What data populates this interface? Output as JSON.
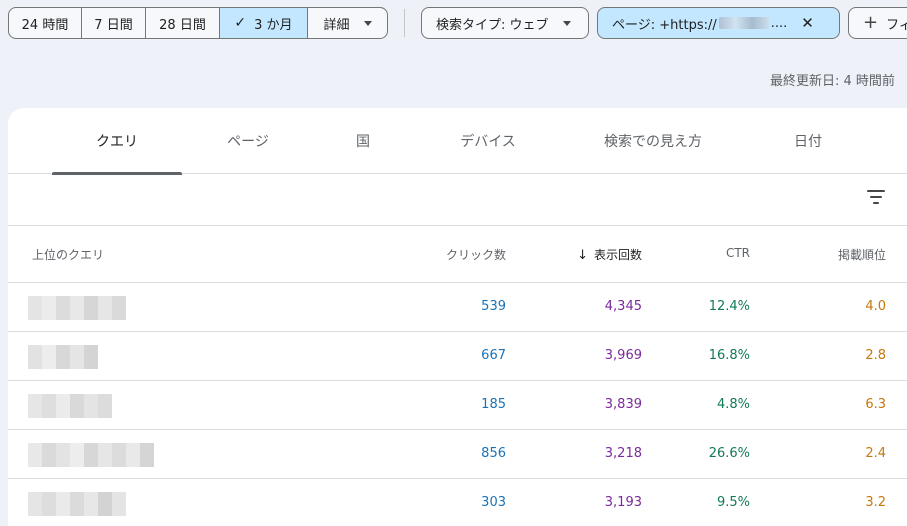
{
  "date_range": {
    "options": [
      "24 時間",
      "7 日間",
      "28 日間",
      "3 か月"
    ],
    "selected_index": 3,
    "more_label": "詳細"
  },
  "filters": {
    "search_type": "検索タイプ: ウェブ",
    "page_prefix": "ページ: +https://",
    "page_suffix": "....",
    "add_label": "フィ"
  },
  "last_updated": "最終更新日: 4 時間前",
  "tabs": [
    "クエリ",
    "ページ",
    "国",
    "デバイス",
    "検索での見え方",
    "日付"
  ],
  "active_tab": 0,
  "table": {
    "columns": {
      "query": "上位のクエリ",
      "clicks": "クリック数",
      "impressions": "表示回数",
      "ctr": "CTR",
      "position": "掲載順位"
    },
    "sort_arrow": "↓",
    "rows": [
      {
        "clicks": "539",
        "impressions": "4,345",
        "ctr": "12.4%",
        "position": "4.0"
      },
      {
        "clicks": "667",
        "impressions": "3,969",
        "ctr": "16.8%",
        "position": "2.8"
      },
      {
        "clicks": "185",
        "impressions": "3,839",
        "ctr": "4.8%",
        "position": "6.3"
      },
      {
        "clicks": "856",
        "impressions": "3,218",
        "ctr": "26.6%",
        "position": "2.4"
      },
      {
        "clicks": "303",
        "impressions": "3,193",
        "ctr": "9.5%",
        "position": "3.2"
      }
    ]
  },
  "colors": {
    "clicks": "#1a73b8",
    "impressions": "#7b2a9d",
    "ctr": "#137a55",
    "position": "#c5780c",
    "selected_chip": "#c2e7ff"
  }
}
